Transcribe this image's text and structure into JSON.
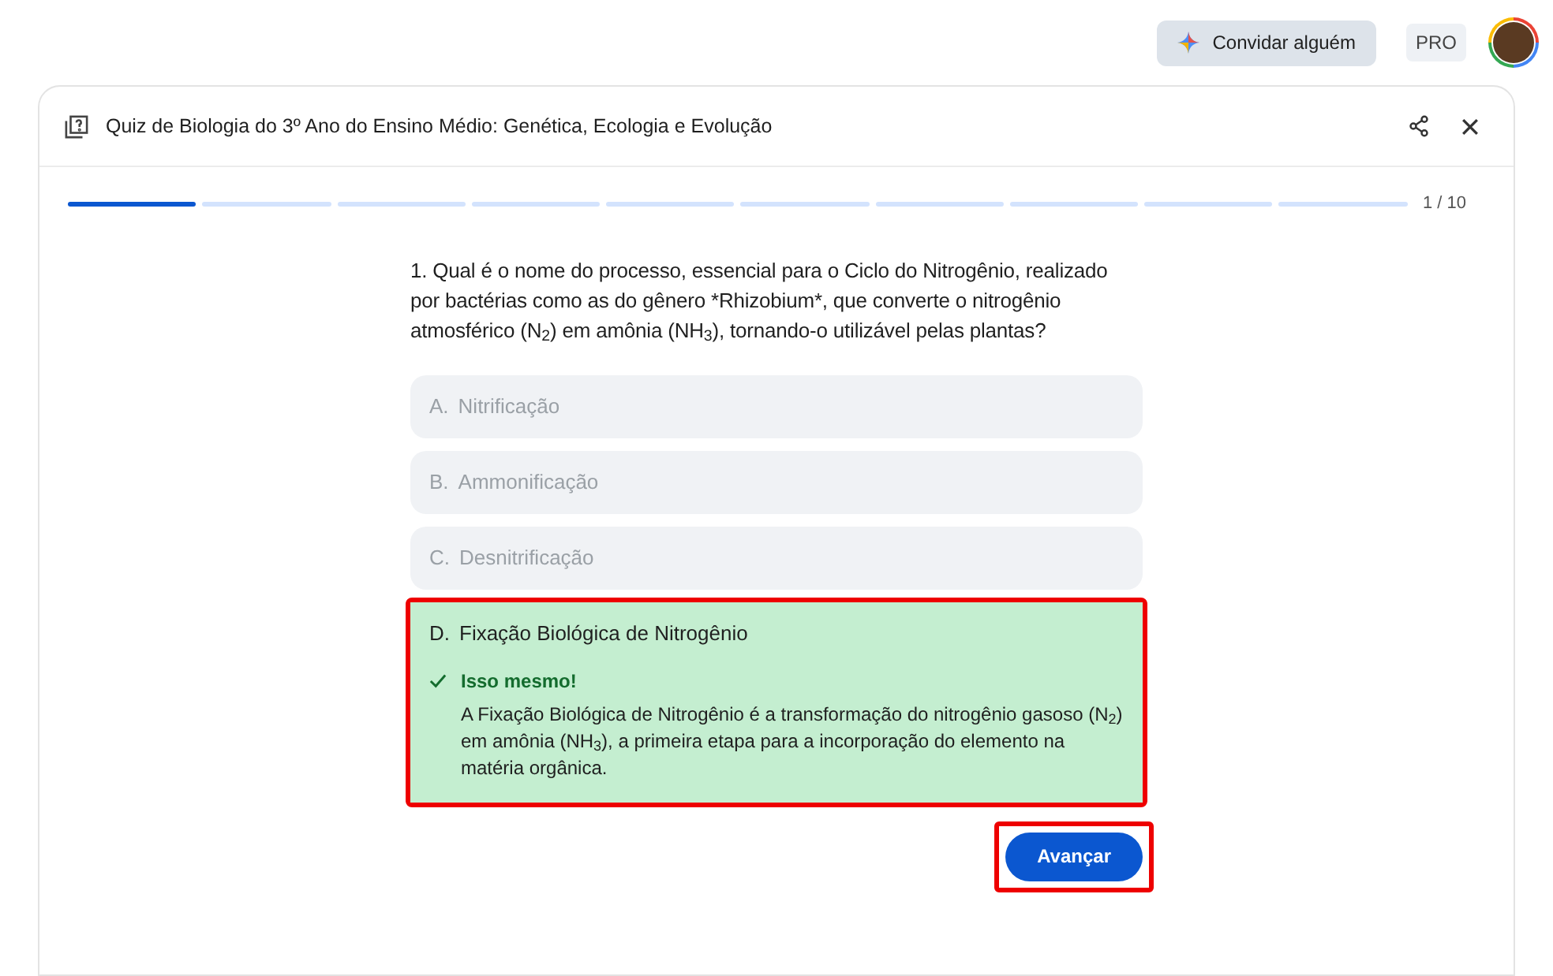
{
  "top_bar": {
    "invite_button": "Convidar alguém",
    "plan_badge": "PRO"
  },
  "quiz": {
    "title": "Quiz de Biologia do 3º Ano do Ensino Médio: Genética, Ecologia e Evolução",
    "progress": [
      {
        "completed": true
      },
      {
        "completed": false
      },
      {
        "completed": false
      },
      {
        "completed": false
      },
      {
        "completed": false
      },
      {
        "completed": false
      },
      {
        "completed": false
      },
      {
        "completed": false
      },
      {
        "completed": false
      },
      {
        "completed": false
      }
    ],
    "counter": "1 / 10",
    "question": [
      "1. Qual é o nome do processo, essencial para o Ciclo do Nitrogênio, realizado por bactérias como as do gênero *",
      "Rhizobium*, que converte o nitrogênio atmosférico (N$_{2}$) em amônia (NH$_{3}$), tornando-o utilizável pelas plantas?"
    ],
    "options": [
      {
        "letter": "A.",
        "text": "Nitrificação",
        "selected": false,
        "highlighted": false
      },
      {
        "letter": "B.",
        "text": "Ammonificação",
        "selected": false,
        "highlighted": false
      },
      {
        "letter": "C.",
        "text": "Desnitrificação",
        "selected": false,
        "highlighted": false
      },
      {
        "letter": "D.",
        "text": "Fixação Biológica de Nitrogênio",
        "selected": true,
        "correct": true,
        "highlighted": true,
        "feedback_title": "Isso mesmo!",
        "feedback": "A Fixação Biológica de Nitrogênio é a transformação do nitrogênio gasoso (N$_{2}$) em amônia (NH$_{3}$), a primeira etapa para a incorporação do elemento na matéria orgânica."
      }
    ],
    "next_button": {
      "label": "Avançar",
      "highlighted": true
    }
  }
}
